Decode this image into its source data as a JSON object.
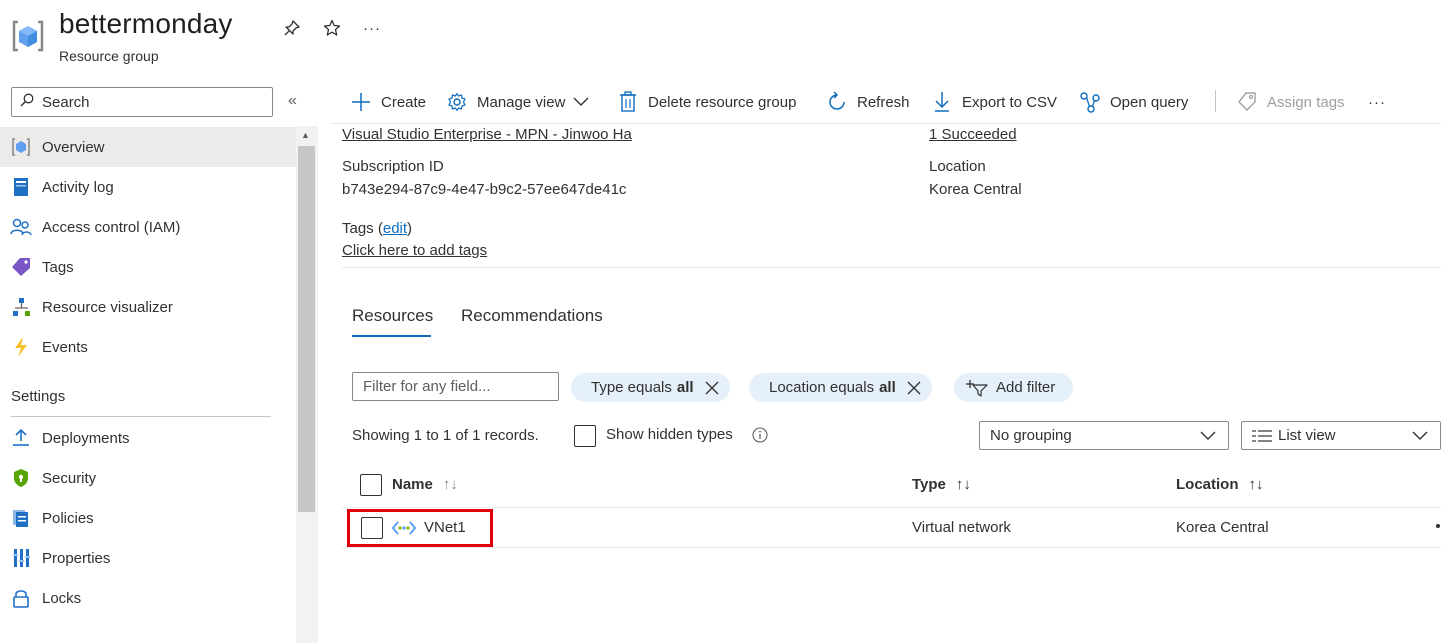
{
  "header": {
    "title": "bettermonday",
    "subtitle": "Resource group",
    "icons": [
      "resource-group-icon",
      "pin-icon",
      "star-icon",
      "more-icon"
    ],
    "more_label": "···"
  },
  "sidebar": {
    "search_placeholder": "Search",
    "collapse_label": "«",
    "items": [
      {
        "label": "Overview",
        "icon": "overview-icon",
        "active": true
      },
      {
        "label": "Activity log",
        "icon": "activity-log-icon"
      },
      {
        "label": "Access control (IAM)",
        "icon": "iam-icon"
      },
      {
        "label": "Tags",
        "icon": "tag-icon"
      },
      {
        "label": "Resource visualizer",
        "icon": "visualizer-icon"
      },
      {
        "label": "Events",
        "icon": "lightning-icon"
      }
    ],
    "section_settings": "Settings",
    "settings_items": [
      {
        "label": "Deployments",
        "icon": "deploy-icon"
      },
      {
        "label": "Security",
        "icon": "shield-icon"
      },
      {
        "label": "Policies",
        "icon": "policy-icon"
      },
      {
        "label": "Properties",
        "icon": "properties-icon"
      },
      {
        "label": "Locks",
        "icon": "lock-icon"
      }
    ]
  },
  "toolbar": {
    "create": "Create",
    "manage_view": "Manage view",
    "delete": "Delete resource group",
    "refresh": "Refresh",
    "export": "Export to CSV",
    "open_query": "Open query",
    "assign_tags": "Assign tags",
    "more": "···"
  },
  "essentials": {
    "subscription_link": "Visual Studio Enterprise - MPN - Jinwoo Ha",
    "deployments_link": "1 Succeeded",
    "subscription_id_label": "Subscription ID",
    "subscription_id": "b743e294-87c9-4e47-b9c2-57ee647de41c",
    "location_label": "Location",
    "location": "Korea Central",
    "tags_label": "Tags (",
    "tags_edit": "edit",
    "tags_close": ")",
    "tags_add": "Click here to add tags"
  },
  "tabs": {
    "resources": "Resources",
    "recommendations": "Recommendations"
  },
  "filters": {
    "placeholder": "Filter for any field...",
    "type_prefix": "Type equals",
    "type_value": "all",
    "location_prefix": "Location equals",
    "location_value": "all",
    "add_filter": "Add filter"
  },
  "records": {
    "summary": "Showing 1 to 1 of 1 records.",
    "show_hidden": "Show hidden types",
    "grouping": "No grouping",
    "view": "List view"
  },
  "table": {
    "columns": {
      "name": "Name",
      "type": "Type",
      "location": "Location",
      "sort_symbol": "↑↓"
    },
    "rows": [
      {
        "name": "VNet1",
        "type": "Virtual network",
        "location": "Korea Central",
        "icon": "vnet-icon"
      }
    ]
  }
}
